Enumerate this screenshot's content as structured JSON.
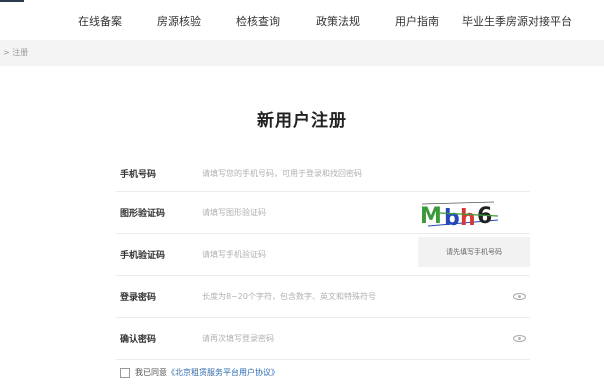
{
  "nav": {
    "items": [
      "在线备案",
      "房源核验",
      "检核查询",
      "政策法规",
      "用户指南",
      "毕业生季房源对接平台"
    ]
  },
  "breadcrumb": {
    "text": "> 注册"
  },
  "page": {
    "title": "新用户注册"
  },
  "form": {
    "phone": {
      "label": "手机号码",
      "placeholder": "请填写您的手机号码，可用于登录和找回密码"
    },
    "captcha": {
      "label": "图形验证码",
      "placeholder": "请填写图形验证码",
      "image_text": "Mbh6"
    },
    "sms": {
      "label": "手机验证码",
      "placeholder": "请填写手机验证码",
      "button": "请先填写手机号码"
    },
    "password": {
      "label": "登录密码",
      "placeholder": "长度为8~20个字符，包含数字、英文和特殊符号"
    },
    "confirm": {
      "label": "确认密码",
      "placeholder": "请再次填写登录密码"
    }
  },
  "agreement": {
    "prefix": "我已同意",
    "link": "《北京租赁服务平台用户协议》"
  },
  "icons": {
    "password_toggle": "eye-icon",
    "agree_checkbox": "checkbox-icon"
  },
  "colors": {
    "link": "#2b6bb0",
    "captcha_green": "#3a9a3a",
    "captcha_blue": "#2448b8",
    "captcha_red": "#d23a3a"
  }
}
